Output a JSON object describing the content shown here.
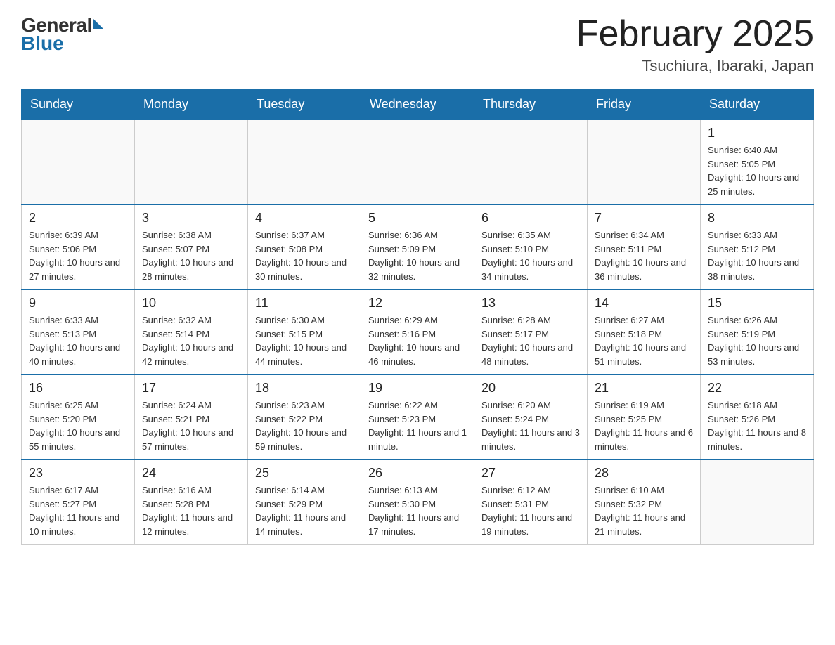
{
  "header": {
    "logo_general": "General",
    "logo_blue": "Blue",
    "title": "February 2025",
    "subtitle": "Tsuchiura, Ibaraki, Japan"
  },
  "days_of_week": [
    "Sunday",
    "Monday",
    "Tuesday",
    "Wednesday",
    "Thursday",
    "Friday",
    "Saturday"
  ],
  "weeks": [
    [
      {
        "day": "",
        "info": ""
      },
      {
        "day": "",
        "info": ""
      },
      {
        "day": "",
        "info": ""
      },
      {
        "day": "",
        "info": ""
      },
      {
        "day": "",
        "info": ""
      },
      {
        "day": "",
        "info": ""
      },
      {
        "day": "1",
        "info": "Sunrise: 6:40 AM\nSunset: 5:05 PM\nDaylight: 10 hours and 25 minutes."
      }
    ],
    [
      {
        "day": "2",
        "info": "Sunrise: 6:39 AM\nSunset: 5:06 PM\nDaylight: 10 hours and 27 minutes."
      },
      {
        "day": "3",
        "info": "Sunrise: 6:38 AM\nSunset: 5:07 PM\nDaylight: 10 hours and 28 minutes."
      },
      {
        "day": "4",
        "info": "Sunrise: 6:37 AM\nSunset: 5:08 PM\nDaylight: 10 hours and 30 minutes."
      },
      {
        "day": "5",
        "info": "Sunrise: 6:36 AM\nSunset: 5:09 PM\nDaylight: 10 hours and 32 minutes."
      },
      {
        "day": "6",
        "info": "Sunrise: 6:35 AM\nSunset: 5:10 PM\nDaylight: 10 hours and 34 minutes."
      },
      {
        "day": "7",
        "info": "Sunrise: 6:34 AM\nSunset: 5:11 PM\nDaylight: 10 hours and 36 minutes."
      },
      {
        "day": "8",
        "info": "Sunrise: 6:33 AM\nSunset: 5:12 PM\nDaylight: 10 hours and 38 minutes."
      }
    ],
    [
      {
        "day": "9",
        "info": "Sunrise: 6:33 AM\nSunset: 5:13 PM\nDaylight: 10 hours and 40 minutes."
      },
      {
        "day": "10",
        "info": "Sunrise: 6:32 AM\nSunset: 5:14 PM\nDaylight: 10 hours and 42 minutes."
      },
      {
        "day": "11",
        "info": "Sunrise: 6:30 AM\nSunset: 5:15 PM\nDaylight: 10 hours and 44 minutes."
      },
      {
        "day": "12",
        "info": "Sunrise: 6:29 AM\nSunset: 5:16 PM\nDaylight: 10 hours and 46 minutes."
      },
      {
        "day": "13",
        "info": "Sunrise: 6:28 AM\nSunset: 5:17 PM\nDaylight: 10 hours and 48 minutes."
      },
      {
        "day": "14",
        "info": "Sunrise: 6:27 AM\nSunset: 5:18 PM\nDaylight: 10 hours and 51 minutes."
      },
      {
        "day": "15",
        "info": "Sunrise: 6:26 AM\nSunset: 5:19 PM\nDaylight: 10 hours and 53 minutes."
      }
    ],
    [
      {
        "day": "16",
        "info": "Sunrise: 6:25 AM\nSunset: 5:20 PM\nDaylight: 10 hours and 55 minutes."
      },
      {
        "day": "17",
        "info": "Sunrise: 6:24 AM\nSunset: 5:21 PM\nDaylight: 10 hours and 57 minutes."
      },
      {
        "day": "18",
        "info": "Sunrise: 6:23 AM\nSunset: 5:22 PM\nDaylight: 10 hours and 59 minutes."
      },
      {
        "day": "19",
        "info": "Sunrise: 6:22 AM\nSunset: 5:23 PM\nDaylight: 11 hours and 1 minute."
      },
      {
        "day": "20",
        "info": "Sunrise: 6:20 AM\nSunset: 5:24 PM\nDaylight: 11 hours and 3 minutes."
      },
      {
        "day": "21",
        "info": "Sunrise: 6:19 AM\nSunset: 5:25 PM\nDaylight: 11 hours and 6 minutes."
      },
      {
        "day": "22",
        "info": "Sunrise: 6:18 AM\nSunset: 5:26 PM\nDaylight: 11 hours and 8 minutes."
      }
    ],
    [
      {
        "day": "23",
        "info": "Sunrise: 6:17 AM\nSunset: 5:27 PM\nDaylight: 11 hours and 10 minutes."
      },
      {
        "day": "24",
        "info": "Sunrise: 6:16 AM\nSunset: 5:28 PM\nDaylight: 11 hours and 12 minutes."
      },
      {
        "day": "25",
        "info": "Sunrise: 6:14 AM\nSunset: 5:29 PM\nDaylight: 11 hours and 14 minutes."
      },
      {
        "day": "26",
        "info": "Sunrise: 6:13 AM\nSunset: 5:30 PM\nDaylight: 11 hours and 17 minutes."
      },
      {
        "day": "27",
        "info": "Sunrise: 6:12 AM\nSunset: 5:31 PM\nDaylight: 11 hours and 19 minutes."
      },
      {
        "day": "28",
        "info": "Sunrise: 6:10 AM\nSunset: 5:32 PM\nDaylight: 11 hours and 21 minutes."
      },
      {
        "day": "",
        "info": ""
      }
    ]
  ]
}
